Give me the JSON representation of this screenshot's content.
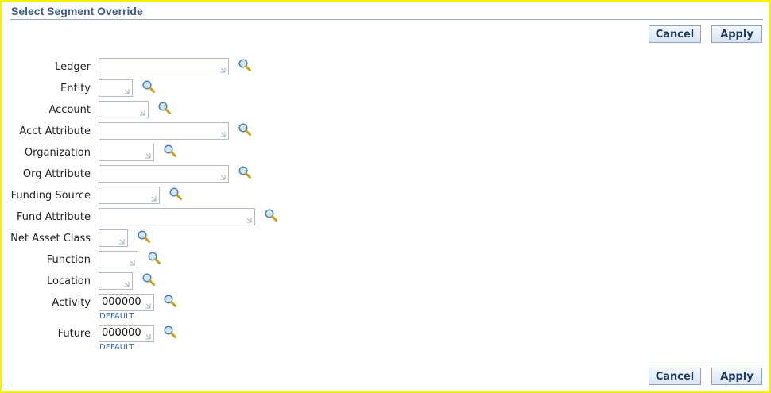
{
  "header": {
    "title": "Select Segment Override"
  },
  "actions": {
    "cancel_label": "Cancel",
    "apply_label": "Apply"
  },
  "fields": [
    {
      "key": "ledger",
      "label": "Ledger",
      "value": ""
    },
    {
      "key": "entity",
      "label": "Entity",
      "value": ""
    },
    {
      "key": "account",
      "label": "Account",
      "value": ""
    },
    {
      "key": "acct-attribute",
      "label": "Acct Attribute",
      "value": ""
    },
    {
      "key": "organization",
      "label": "Organization",
      "value": ""
    },
    {
      "key": "org-attribute",
      "label": "Org Attribute",
      "value": ""
    },
    {
      "key": "funding-source",
      "label": "Funding Source",
      "value": ""
    },
    {
      "key": "fund-attribute",
      "label": "Fund Attribute",
      "value": ""
    },
    {
      "key": "net-asset-class",
      "label": "Net Asset Class",
      "value": ""
    },
    {
      "key": "function",
      "label": "Function",
      "value": ""
    },
    {
      "key": "location",
      "label": "Location",
      "value": ""
    },
    {
      "key": "activity",
      "label": "Activity",
      "value": "000000",
      "hint": "DEFAULT"
    },
    {
      "key": "future",
      "label": "Future",
      "value": "000000",
      "hint": "DEFAULT"
    }
  ],
  "icons": {
    "search": "search-icon",
    "resize": "resize-corner-icon"
  }
}
